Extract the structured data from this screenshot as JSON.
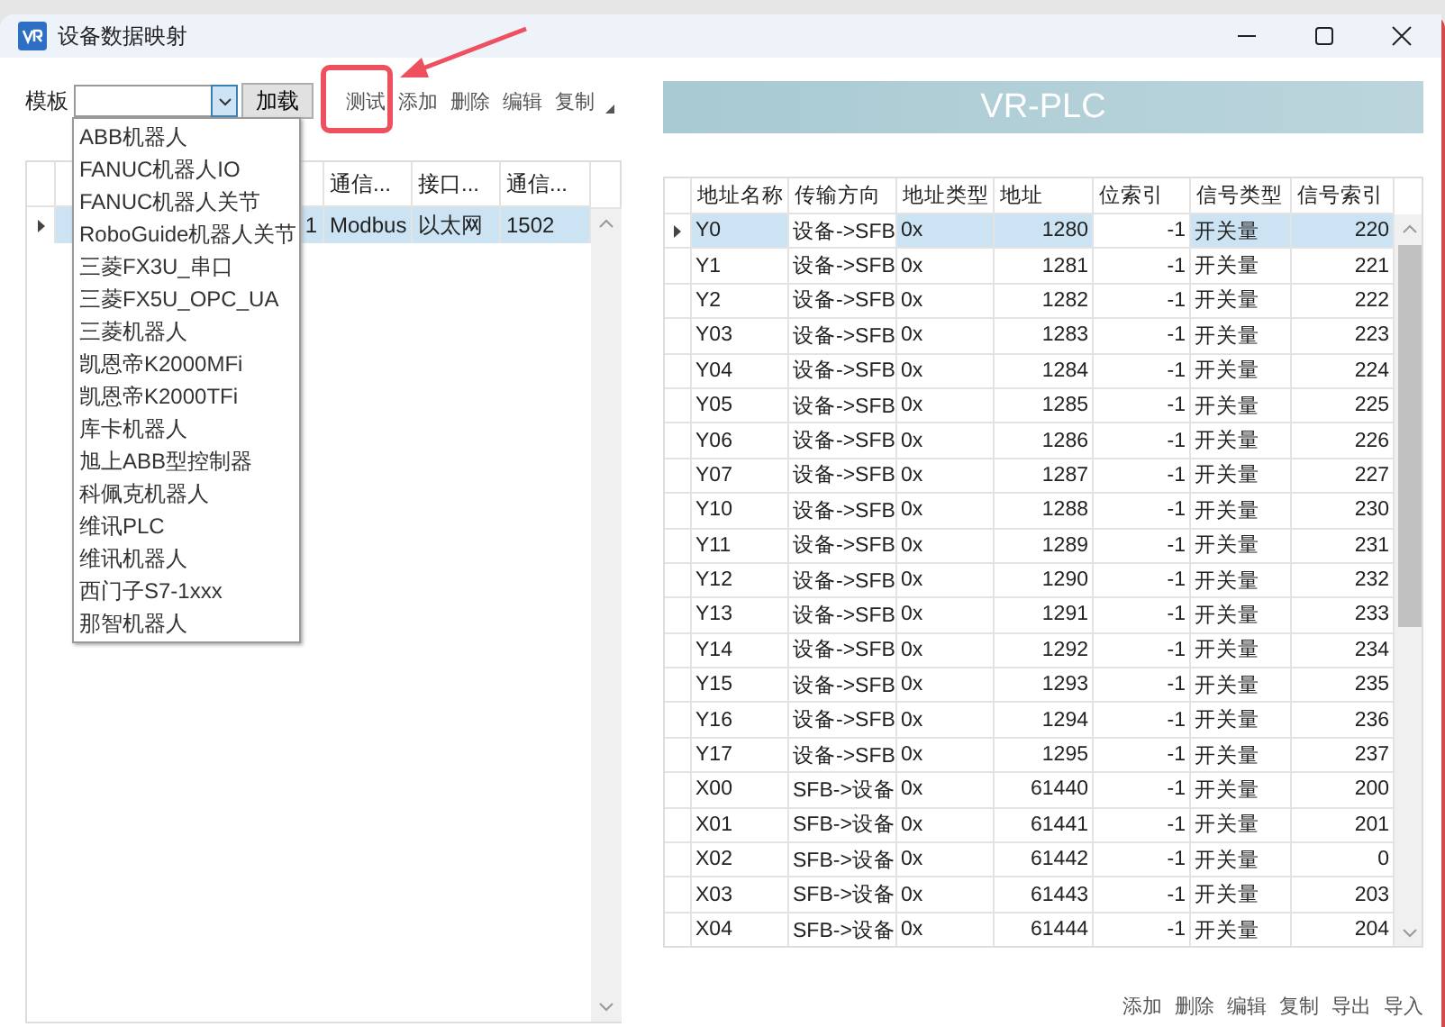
{
  "window": {
    "title": "设备数据映射"
  },
  "template": {
    "label": "模板",
    "button": "加载",
    "expanded": true,
    "options": [
      "ABB机器人",
      "FANUC机器人IO",
      "FANUC机器人关节",
      "RoboGuide机器人关节",
      "三菱FX3U_串口",
      "三菱FX5U_OPC_UA",
      "三菱机器人",
      "凯恩帝K2000MFi",
      "凯恩帝K2000TFi",
      "库卡机器人",
      "旭上ABB型控制器",
      "科佩克机器人",
      "维讯PLC",
      "维讯机器人",
      "西门子S7-1xxx",
      "那智机器人"
    ]
  },
  "device_toolbar": [
    {
      "label": "测试",
      "highlighted": true
    },
    {
      "label": "添加",
      "highlighted": false
    },
    {
      "label": "删除",
      "highlighted": false
    },
    {
      "label": "编辑",
      "highlighted": false
    },
    {
      "label": "复制",
      "highlighted": false
    }
  ],
  "device_table": {
    "columns": [
      "",
      "",
      "通信...",
      "接口...",
      "通信..."
    ],
    "rows": [
      {
        "selected": true,
        "cells": [
          "",
          "1",
          "Modbus",
          "以太网",
          "1502"
        ]
      }
    ]
  },
  "banner": "VR-PLC",
  "mapping_table": {
    "columns": [
      "地址名称",
      "传输方向",
      "地址类型",
      "地址",
      "位索引",
      "信号类型",
      "信号索引"
    ],
    "rows": [
      {
        "selected": true,
        "cells": [
          "Y0",
          "设备->SFB",
          "0x",
          "1280",
          "-1",
          "开关量",
          "220"
        ]
      },
      {
        "selected": false,
        "cells": [
          "Y1",
          "设备->SFB",
          "0x",
          "1281",
          "-1",
          "开关量",
          "221"
        ]
      },
      {
        "selected": false,
        "cells": [
          "Y2",
          "设备->SFB",
          "0x",
          "1282",
          "-1",
          "开关量",
          "222"
        ]
      },
      {
        "selected": false,
        "cells": [
          "Y03",
          "设备->SFB",
          "0x",
          "1283",
          "-1",
          "开关量",
          "223"
        ]
      },
      {
        "selected": false,
        "cells": [
          "Y04",
          "设备->SFB",
          "0x",
          "1284",
          "-1",
          "开关量",
          "224"
        ]
      },
      {
        "selected": false,
        "cells": [
          "Y05",
          "设备->SFB",
          "0x",
          "1285",
          "-1",
          "开关量",
          "225"
        ]
      },
      {
        "selected": false,
        "cells": [
          "Y06",
          "设备->SFB",
          "0x",
          "1286",
          "-1",
          "开关量",
          "226"
        ]
      },
      {
        "selected": false,
        "cells": [
          "Y07",
          "设备->SFB",
          "0x",
          "1287",
          "-1",
          "开关量",
          "227"
        ]
      },
      {
        "selected": false,
        "cells": [
          "Y10",
          "设备->SFB",
          "0x",
          "1288",
          "-1",
          "开关量",
          "230"
        ]
      },
      {
        "selected": false,
        "cells": [
          "Y11",
          "设备->SFB",
          "0x",
          "1289",
          "-1",
          "开关量",
          "231"
        ]
      },
      {
        "selected": false,
        "cells": [
          "Y12",
          "设备->SFB",
          "0x",
          "1290",
          "-1",
          "开关量",
          "232"
        ]
      },
      {
        "selected": false,
        "cells": [
          "Y13",
          "设备->SFB",
          "0x",
          "1291",
          "-1",
          "开关量",
          "233"
        ]
      },
      {
        "selected": false,
        "cells": [
          "Y14",
          "设备->SFB",
          "0x",
          "1292",
          "-1",
          "开关量",
          "234"
        ]
      },
      {
        "selected": false,
        "cells": [
          "Y15",
          "设备->SFB",
          "0x",
          "1293",
          "-1",
          "开关量",
          "235"
        ]
      },
      {
        "selected": false,
        "cells": [
          "Y16",
          "设备->SFB",
          "0x",
          "1294",
          "-1",
          "开关量",
          "236"
        ]
      },
      {
        "selected": false,
        "cells": [
          "Y17",
          "设备->SFB",
          "0x",
          "1295",
          "-1",
          "开关量",
          "237"
        ]
      },
      {
        "selected": false,
        "cells": [
          "X00",
          "SFB->设备",
          "0x",
          "61440",
          "-1",
          "开关量",
          "200"
        ]
      },
      {
        "selected": false,
        "cells": [
          "X01",
          "SFB->设备",
          "0x",
          "61441",
          "-1",
          "开关量",
          "201"
        ]
      },
      {
        "selected": false,
        "cells": [
          "X02",
          "SFB->设备",
          "0x",
          "61442",
          "-1",
          "开关量",
          "0"
        ]
      },
      {
        "selected": false,
        "cells": [
          "X03",
          "SFB->设备",
          "0x",
          "61443",
          "-1",
          "开关量",
          "203"
        ]
      },
      {
        "selected": false,
        "cells": [
          "X04",
          "SFB->设备",
          "0x",
          "61444",
          "-1",
          "开关量",
          "204"
        ]
      }
    ]
  },
  "mapping_toolbar": [
    "添加",
    "删除",
    "编辑",
    "复制",
    "导出",
    "导入"
  ]
}
